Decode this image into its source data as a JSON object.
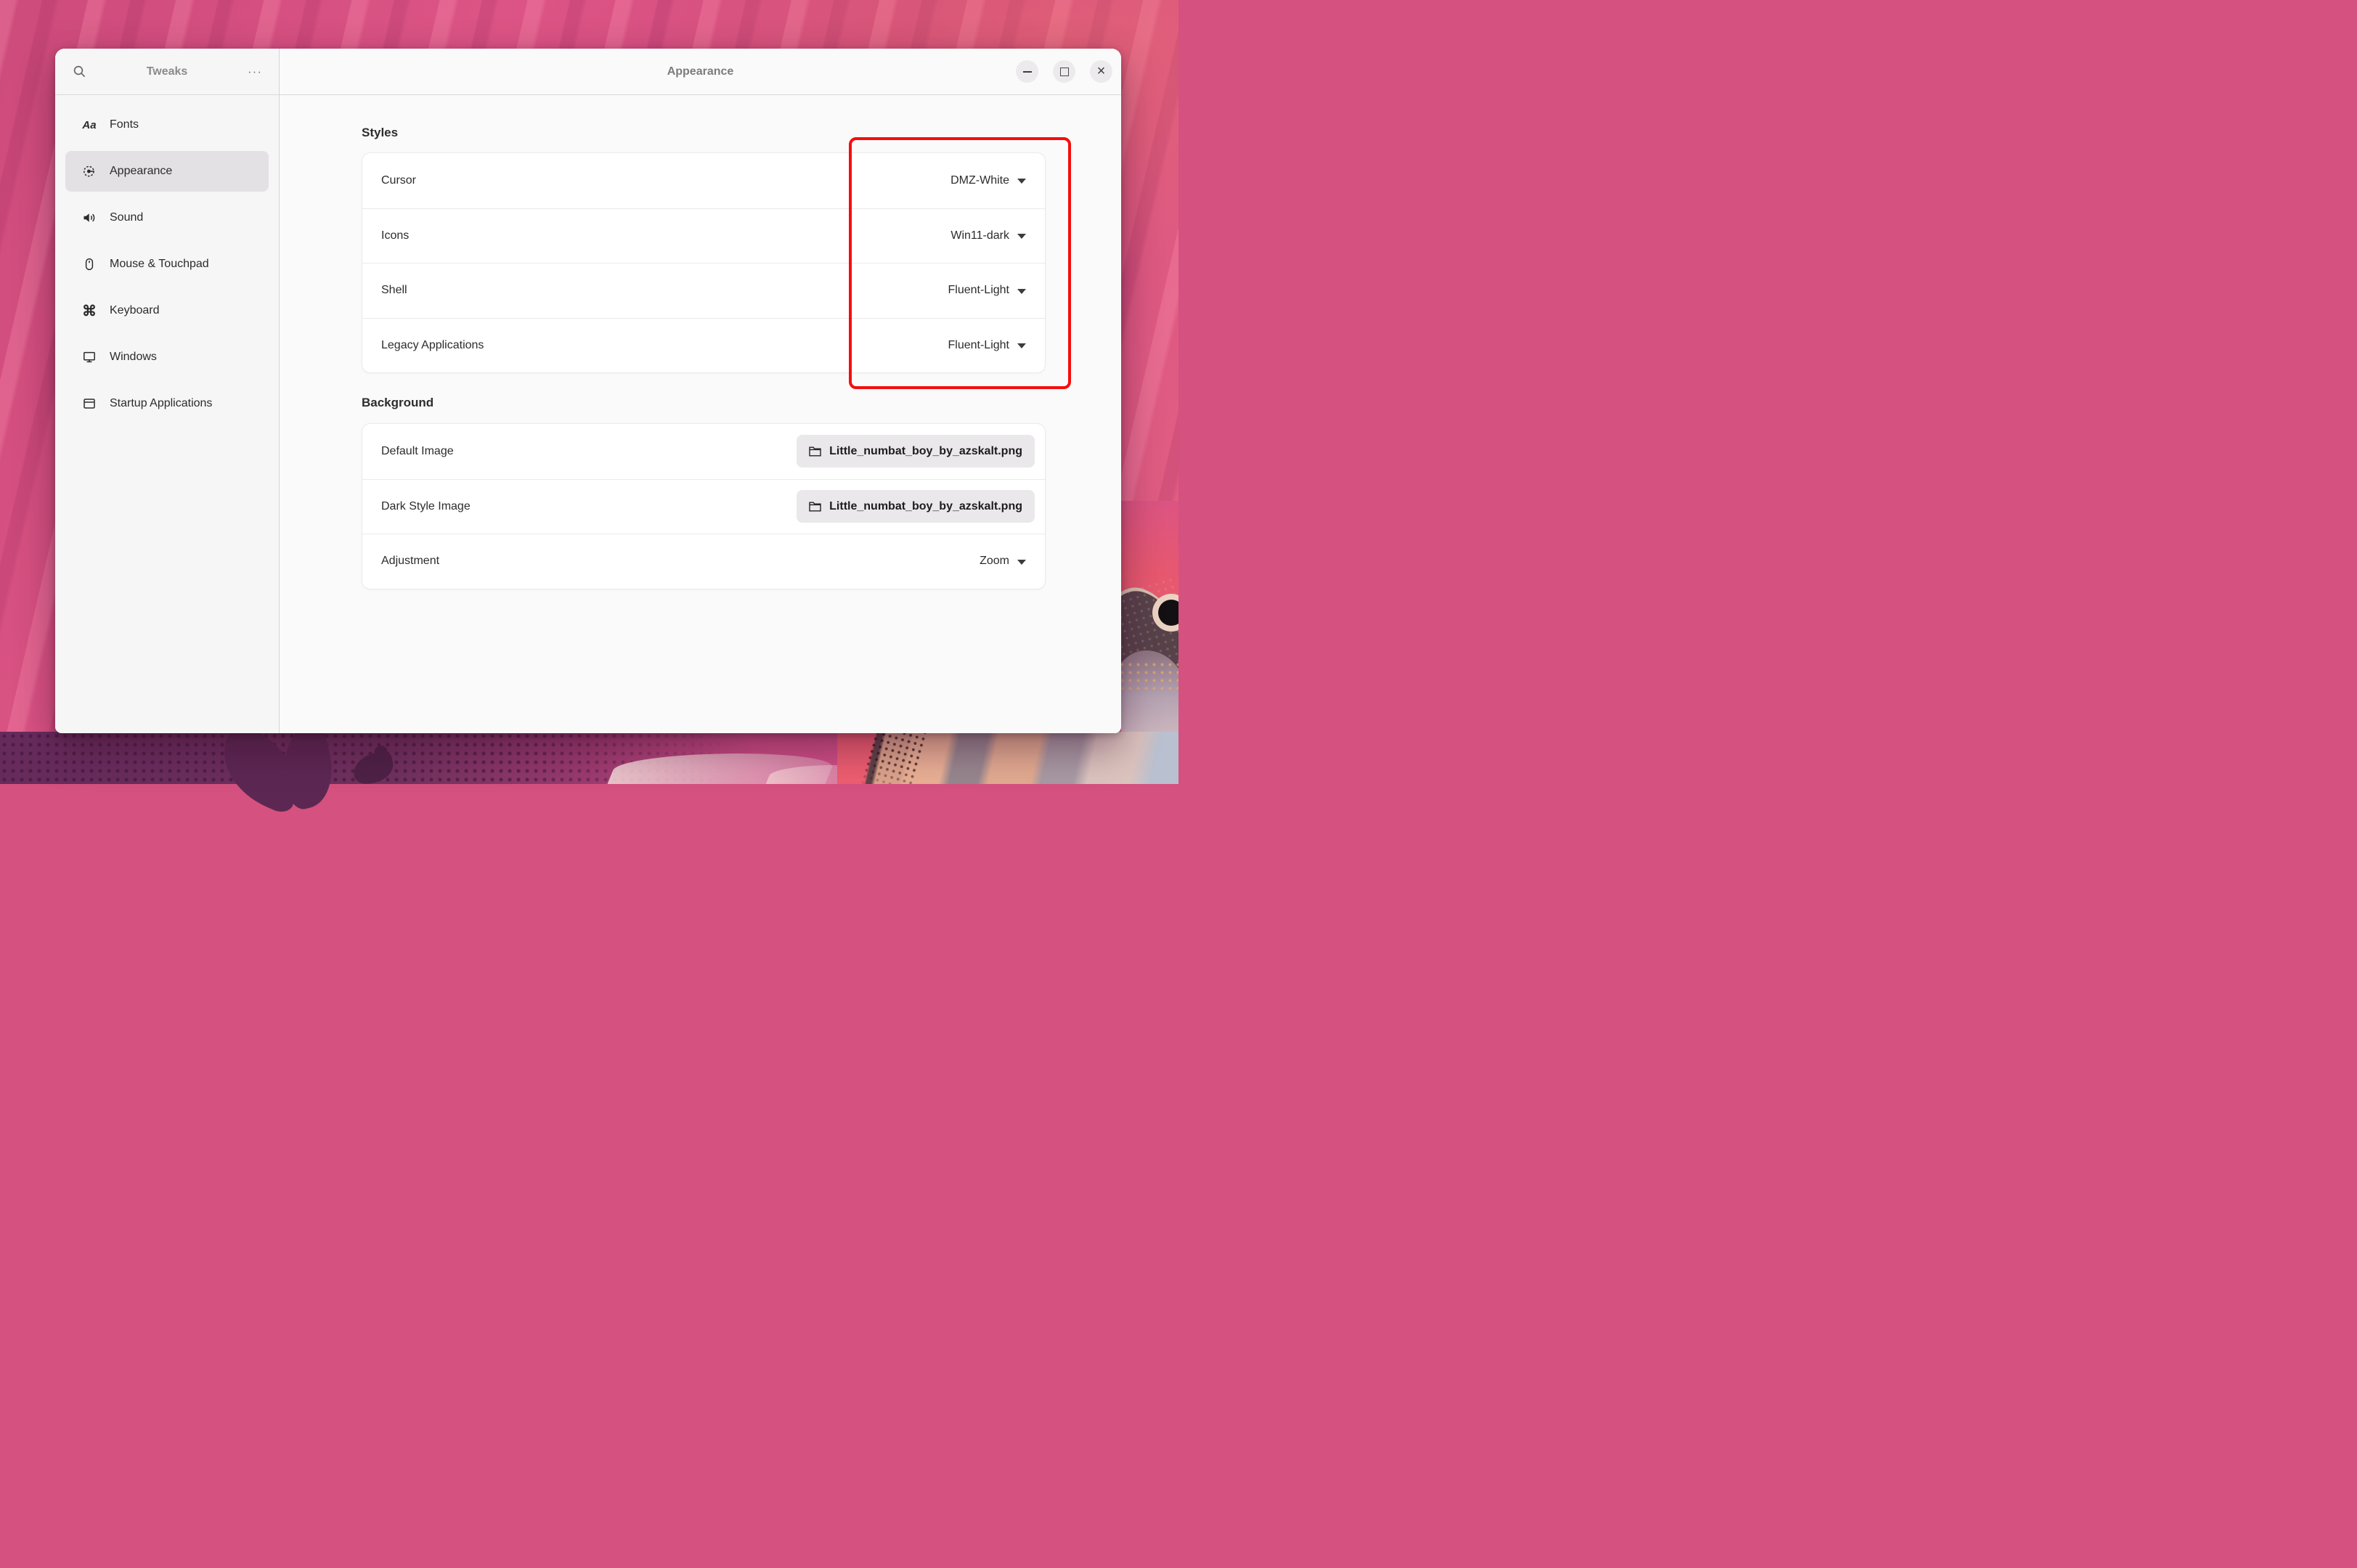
{
  "wallpaper": {
    "description": "pink magenta streaked wallpaper with numbat artwork bottom right",
    "base_color": "#d5517f",
    "dark_bottom_color": "#6b2d60"
  },
  "window": {
    "sidebar": {
      "title": "Tweaks",
      "menu_glyph": "···",
      "items": [
        {
          "id": "fonts",
          "label": "Fonts",
          "icon": "fonts-icon",
          "glyph": "Aa",
          "selected": false
        },
        {
          "id": "appearance",
          "label": "Appearance",
          "icon": "appearance-icon",
          "selected": true
        },
        {
          "id": "sound",
          "label": "Sound",
          "icon": "sound-icon",
          "selected": false
        },
        {
          "id": "mouse-touchpad",
          "label": "Mouse & Touchpad",
          "icon": "mouse-icon",
          "selected": false
        },
        {
          "id": "keyboard",
          "label": "Keyboard",
          "icon": "keyboard-icon",
          "glyph": "⌘",
          "selected": false
        },
        {
          "id": "windows",
          "label": "Windows",
          "icon": "windows-icon",
          "selected": false
        },
        {
          "id": "startup-applications",
          "label": "Startup Applications",
          "icon": "startup-applications-icon",
          "selected": false
        }
      ]
    },
    "main": {
      "title": "Appearance",
      "window_controls": [
        {
          "name": "minimize"
        },
        {
          "name": "maximize"
        },
        {
          "name": "close",
          "glyph": "×"
        }
      ],
      "styles": {
        "heading": "Styles",
        "rows": [
          {
            "label": "Cursor",
            "value": "DMZ-White",
            "control": "dropdown"
          },
          {
            "label": "Icons",
            "value": "Win11-dark",
            "control": "dropdown"
          },
          {
            "label": "Shell",
            "value": "Fluent-Light",
            "control": "dropdown"
          },
          {
            "label": "Legacy Applications",
            "value": "Fluent-Light",
            "control": "dropdown"
          }
        ]
      },
      "background": {
        "heading": "Background",
        "rows": [
          {
            "label": "Default Image",
            "value": "Little_numbat_boy_by_azskalt.png",
            "control": "file-button"
          },
          {
            "label": "Dark Style Image",
            "value": "Little_numbat_boy_by_azskalt.png",
            "control": "file-button"
          },
          {
            "label": "Adjustment",
            "value": "Zoom",
            "control": "dropdown"
          }
        ]
      }
    },
    "annotation": {
      "type": "highlight-box",
      "purpose": "red box drawn around the style dropdown values",
      "color": "#f50d0d"
    }
  }
}
